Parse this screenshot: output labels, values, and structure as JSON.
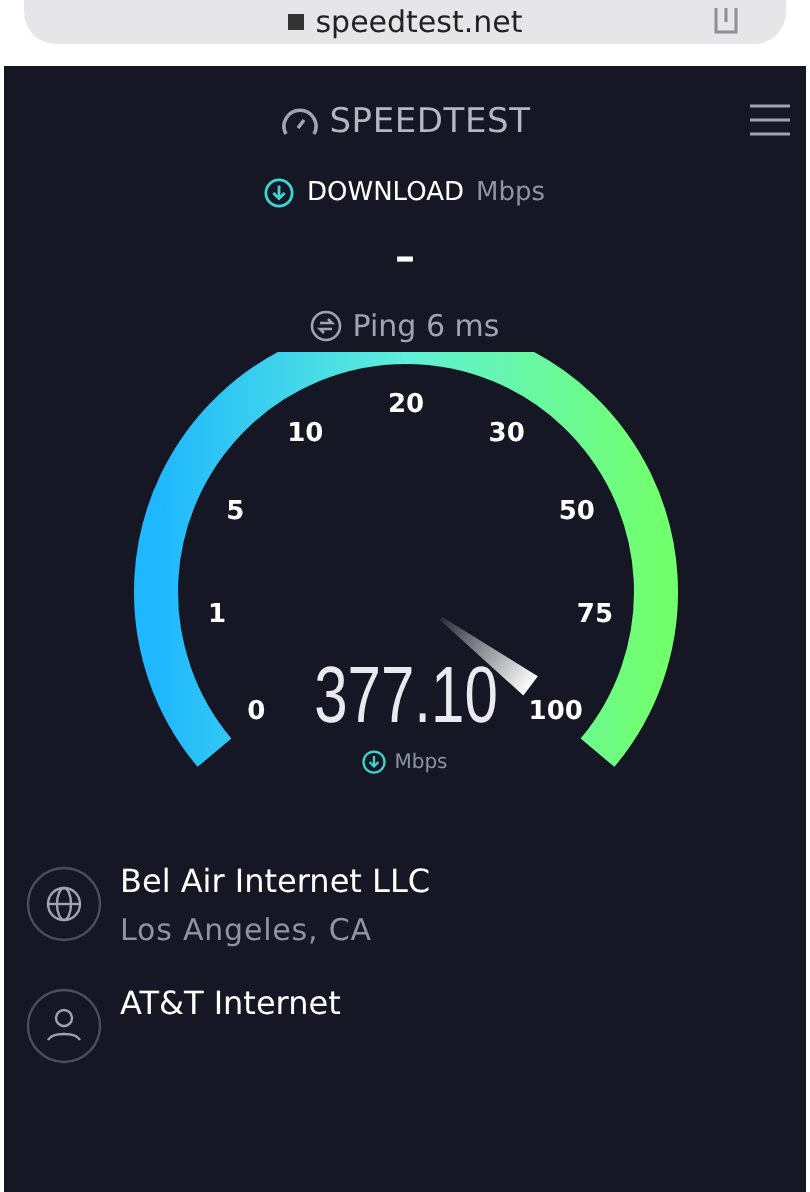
{
  "browser": {
    "url": "speedtest.net"
  },
  "header": {
    "logo": "SPEEDTEST"
  },
  "metric": {
    "label": "DOWNLOAD",
    "unit": "Mbps",
    "value": "–"
  },
  "ping": {
    "text": "Ping 6 ms"
  },
  "gauge": {
    "ticks": [
      "0",
      "1",
      "5",
      "10",
      "20",
      "30",
      "50",
      "75",
      "100"
    ],
    "reading": "377.10",
    "unit": "Mbps"
  },
  "servers": [
    {
      "kind": "globe",
      "name": "Bel Air Internet LLC",
      "location": "Los Angeles, CA"
    },
    {
      "kind": "person",
      "name": "AT&T Internet"
    }
  ]
}
